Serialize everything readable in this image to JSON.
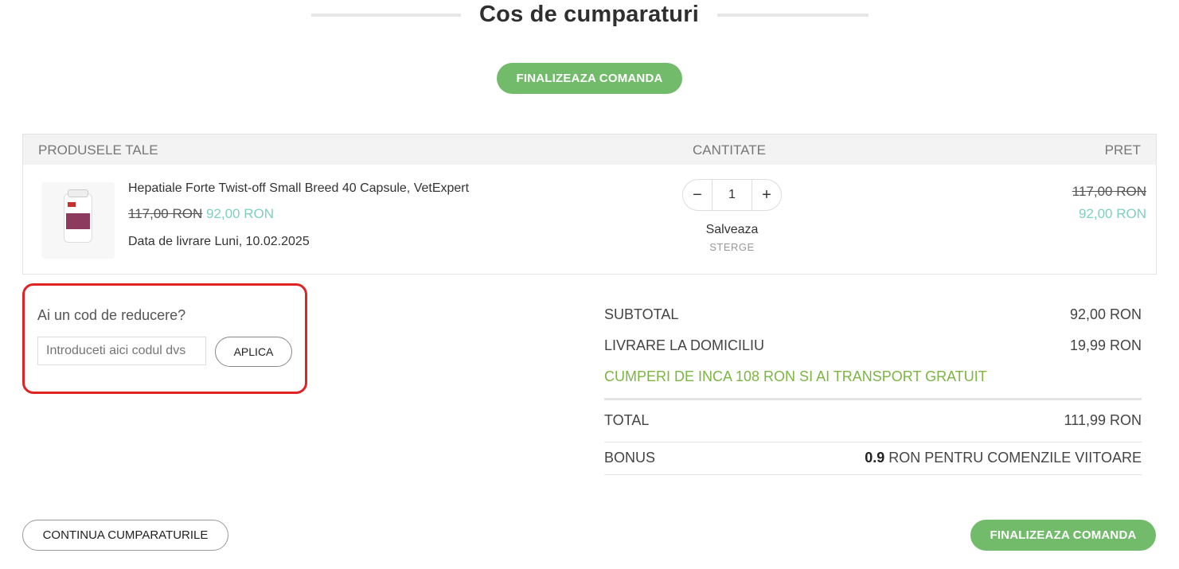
{
  "page": {
    "title": "Cos de cumparaturi"
  },
  "actions": {
    "checkout_label": "FINALIZEAZA COMANDA",
    "continue_label": "CONTINUA CUMPARATURILE"
  },
  "cart": {
    "headers": {
      "products": "PRODUSELE TALE",
      "quantity": "CANTITATE",
      "price": "PRET"
    },
    "item": {
      "name": "Hepatiale Forte Twist-off Small Breed 40 Capsule, VetExpert",
      "old_price": "117,00 RON",
      "new_price": "92,00 RON",
      "delivery": "Data de livrare Luni, 10.02.2025",
      "quantity": "1",
      "minus": "−",
      "plus": "+",
      "save_label": "Salveaza",
      "delete_label": "STERGE",
      "total_old": "117,00 RON",
      "total_new": "92,00 RON"
    }
  },
  "discount": {
    "label": "Ai un cod de reducere?",
    "placeholder": "Introduceti aici codul dvs",
    "apply_label": "APLICA"
  },
  "summary": {
    "subtotal_label": "SUBTOTAL",
    "subtotal_value": "92,00 RON",
    "delivery_label": "LIVRARE LA DOMICILIU",
    "delivery_value": "19,99 RON",
    "free_shipping_msg": "CUMPERI DE INCA 108 RON SI AI TRANSPORT GRATUIT",
    "total_label": "TOTAL",
    "total_value": "111,99 RON",
    "bonus_label": "BONUS",
    "bonus_amount": "0.9",
    "bonus_text": " RON PENTRU COMENZILE VIITOARE"
  },
  "colors": {
    "accent_green": "#72bb6b",
    "price_teal": "#7fcfbf",
    "promo_green": "#7db544",
    "highlight_red": "#e02424"
  }
}
